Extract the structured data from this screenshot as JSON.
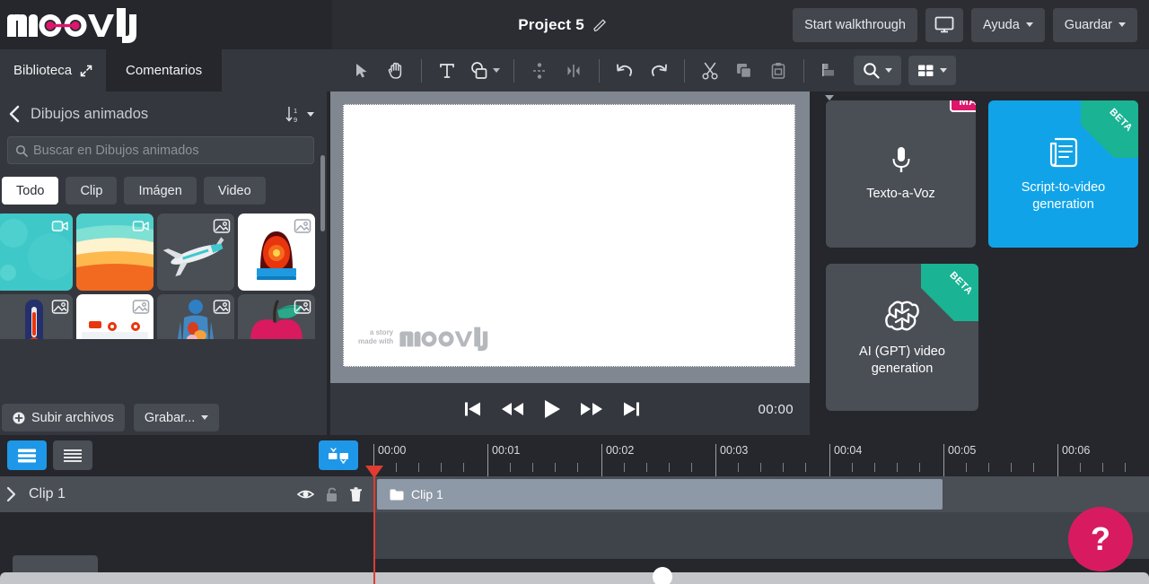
{
  "app": {
    "brand": "moovly"
  },
  "header": {
    "project_title": "Project 5",
    "edit_icon": "pencil-icon",
    "walkthrough_label": "Start walkthrough",
    "present_icon": "monitor-icon",
    "help_label": "Ayuda",
    "save_label": "Guardar"
  },
  "library": {
    "tabs": [
      {
        "label": "Biblioteca",
        "active": true,
        "icon": "expand-diagonal-icon"
      },
      {
        "label": "Comentarios",
        "active": false
      }
    ],
    "breadcrumb": {
      "back_icon": "chevron-left-icon",
      "label": "Dibujos animados"
    },
    "sort": {
      "icon": "sort-numeric-icon"
    },
    "search": {
      "placeholder": "Buscar en Dibujos animados",
      "value": "",
      "icon": "search-icon"
    },
    "filters": [
      {
        "label": "Todo",
        "active": true
      },
      {
        "label": "Clip",
        "active": false
      },
      {
        "label": "Imágen",
        "active": false
      },
      {
        "label": "Video",
        "active": false
      }
    ],
    "assets": [
      {
        "name": "teal-bubbles-background",
        "badge": "video-icon",
        "bg": "#3fc8c8"
      },
      {
        "name": "orange-waves-background",
        "badge": "video-icon",
        "bg": "#f07020"
      },
      {
        "name": "airplane-illustration",
        "badge": "image-icon",
        "bg": "#4a4e55"
      },
      {
        "name": "siren-light-illustration",
        "badge": "image-icon",
        "bg": "#ffffff"
      },
      {
        "name": "thermometer-illustration",
        "badge": "image-icon",
        "bg": "#4a4e55"
      },
      {
        "name": "hospital-building-illustration",
        "badge": "image-icon",
        "bg": "#ffffff"
      },
      {
        "name": "human-anatomy-illustration",
        "badge": "image-icon",
        "bg": "#4a4e55"
      },
      {
        "name": "apple-illustration",
        "badge": "image-icon",
        "bg": "#4a4e55"
      }
    ],
    "footer": {
      "upload_label": "Subir archivos",
      "upload_icon": "plus-circle-icon",
      "record_label": "Grabar..."
    }
  },
  "toolbar": {
    "tools": [
      {
        "name": "select-arrow-tool",
        "icon": "cursor-arrow-icon"
      },
      {
        "name": "pan-hand-tool",
        "icon": "hand-icon"
      },
      {
        "name": "text-tool",
        "icon": "text-t-icon"
      },
      {
        "name": "shapes-tool",
        "icon": "shapes-icon",
        "has_caret": true
      },
      {
        "name": "align-vertical-tool",
        "icon": "align-vertical-icon"
      },
      {
        "name": "align-horizontal-tool",
        "icon": "align-horizontal-icon"
      },
      {
        "name": "undo-tool",
        "icon": "undo-icon"
      },
      {
        "name": "redo-tool",
        "icon": "redo-icon"
      },
      {
        "name": "cut-tool",
        "icon": "scissors-icon"
      },
      {
        "name": "copy-tool",
        "icon": "copy-icon"
      },
      {
        "name": "paste-tool",
        "icon": "paste-icon"
      },
      {
        "name": "arrange-layers-tool",
        "icon": "layers-arrange-icon"
      }
    ],
    "zoom_button": {
      "icon": "magnifier-icon"
    },
    "layout_button": {
      "icon": "grid-layout-icon"
    }
  },
  "canvas": {
    "watermark_line1": "a story",
    "watermark_line2": "made with",
    "watermark_brand": "moovly"
  },
  "player": {
    "controls": [
      {
        "name": "skip-start-button",
        "icon": "skip-start-icon"
      },
      {
        "name": "rewind-button",
        "icon": "rewind-icon"
      },
      {
        "name": "play-button",
        "icon": "play-icon"
      },
      {
        "name": "fast-forward-button",
        "icon": "fast-forward-icon"
      },
      {
        "name": "skip-end-button",
        "icon": "skip-end-icon"
      }
    ],
    "time": "00:00"
  },
  "ai_cards": [
    {
      "name": "text-to-speech-card",
      "label": "Texto-a-Voz",
      "icon": "microphone-icon",
      "badge": "MAX",
      "badge_type": "max",
      "style": "dark"
    },
    {
      "name": "script-to-video-card",
      "label": "Script-to-video generation",
      "icon": "script-scroll-icon",
      "badge": "BETA",
      "badge_type": "ribbon",
      "style": "blue"
    },
    {
      "name": "ai-gpt-video-card",
      "label": "AI (GPT) video generation",
      "icon": "openai-logo-icon",
      "badge": "BETA",
      "badge_type": "ribbon",
      "style": "dark"
    }
  ],
  "timeline": {
    "view_toggles": [
      {
        "name": "timeline-view-blocks",
        "icon": "rows-thick-icon",
        "active": true
      },
      {
        "name": "timeline-view-lines",
        "icon": "rows-thin-icon",
        "active": false
      }
    ],
    "split_button": {
      "name": "split-clip-button",
      "icon": "split-clip-icon"
    },
    "ruler_labels": [
      "00:00",
      "00:01",
      "00:02",
      "00:03",
      "00:04",
      "00:05",
      "00:06"
    ],
    "track": {
      "expand_icon": "chevron-right-icon",
      "name": "Clip 1",
      "icons": [
        {
          "name": "visibility-eye-icon"
        },
        {
          "name": "lock-icon"
        },
        {
          "name": "trash-icon"
        }
      ]
    },
    "clip": {
      "label": "Clip 1",
      "icon": "folder-icon"
    }
  },
  "help_button": {
    "label": "?",
    "color": "#d81b60"
  },
  "colors": {
    "accent_blue": "#11a3e8",
    "brand_pink": "#e0156c",
    "beta_green": "#1ab394",
    "panel_dark": "#34373d",
    "app_bg": "#25272c",
    "playhead_red": "#e03c31"
  }
}
